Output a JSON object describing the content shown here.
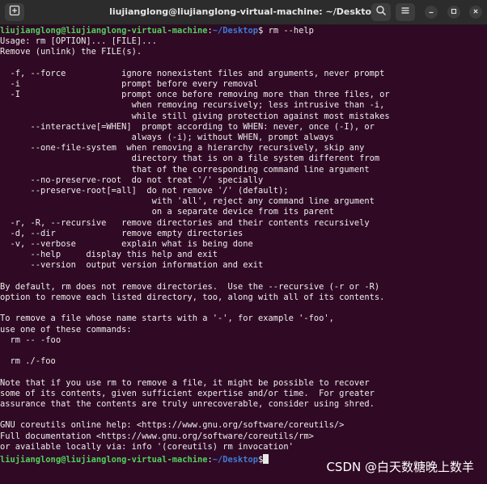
{
  "window": {
    "title": "liujianglong@liujianglong-virtual-machine: ~/Desktop"
  },
  "icons": {
    "new_tab": "new-tab-icon",
    "search": "search-icon",
    "menu": "hamburger-menu-icon",
    "minimize": "minimize-icon",
    "maximize": "maximize-icon",
    "close": "close-icon"
  },
  "colors": {
    "background": "#300a24",
    "titlebar": "#2c2c2c",
    "prompt_user": "#4fd15c",
    "prompt_path": "#3c7bd6",
    "text": "#ededed"
  },
  "prompt": {
    "user_host": "liujianglong@liujianglong-virtual-machine",
    "colon": ":",
    "path": "~/Desktop",
    "dollar": "$"
  },
  "command": " rm --help",
  "output": [
    "Usage: rm [OPTION]... [FILE]...",
    "Remove (unlink) the FILE(s).",
    "",
    "  -f, --force           ignore nonexistent files and arguments, never prompt",
    "  -i                    prompt before every removal",
    "  -I                    prompt once before removing more than three files, or",
    "                          when removing recursively; less intrusive than -i,",
    "                          while still giving protection against most mistakes",
    "      --interactive[=WHEN]  prompt according to WHEN: never, once (-I), or",
    "                          always (-i); without WHEN, prompt always",
    "      --one-file-system  when removing a hierarchy recursively, skip any",
    "                          directory that is on a file system different from",
    "                          that of the corresponding command line argument",
    "      --no-preserve-root  do not treat '/' specially",
    "      --preserve-root[=all]  do not remove '/' (default);",
    "                              with 'all', reject any command line argument",
    "                              on a separate device from its parent",
    "  -r, -R, --recursive   remove directories and their contents recursively",
    "  -d, --dir             remove empty directories",
    "  -v, --verbose         explain what is being done",
    "      --help     display this help and exit",
    "      --version  output version information and exit",
    "",
    "By default, rm does not remove directories.  Use the --recursive (-r or -R)",
    "option to remove each listed directory, too, along with all of its contents.",
    "",
    "To remove a file whose name starts with a '-', for example '-foo',",
    "use one of these commands:",
    "  rm -- -foo",
    "",
    "  rm ./-foo",
    "",
    "Note that if you use rm to remove a file, it might be possible to recover",
    "some of its contents, given sufficient expertise and/or time.  For greater",
    "assurance that the contents are truly unrecoverable, consider using shred.",
    "",
    "GNU coreutils online help: <https://www.gnu.org/software/coreutils/>",
    "Full documentation <https://www.gnu.org/software/coreutils/rm>",
    "or available locally via: info '(coreutils) rm invocation'"
  ],
  "watermark": "CSDN @白天数糖晚上数羊"
}
